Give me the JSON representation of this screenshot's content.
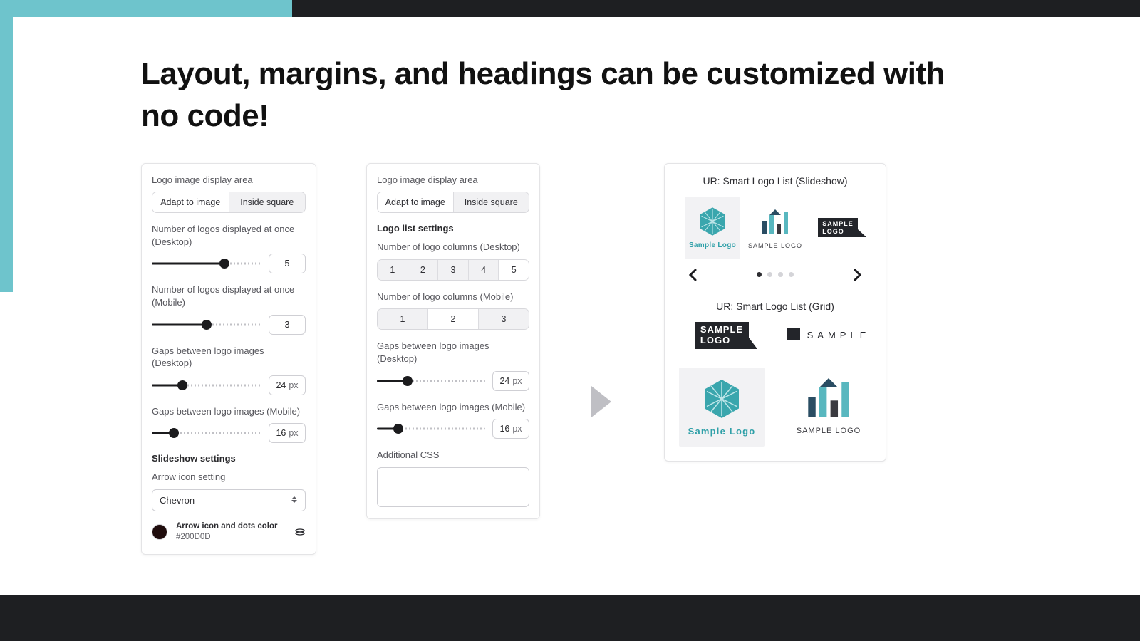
{
  "headline": "Layout, margins, and headings can be customized with no code!",
  "panelA": {
    "displayArea": {
      "label": "Logo image display area",
      "opt1": "Adapt to image",
      "opt2": "Inside square"
    },
    "logosDesktop": {
      "label": "Number of logos displayed at once (Desktop)",
      "value": "5",
      "pct": 66
    },
    "logosMobile": {
      "label": "Number of logos displayed at once (Mobile)",
      "value": "3",
      "pct": 50
    },
    "gapDesktop": {
      "label": "Gaps between logo images (Desktop)",
      "value": "24",
      "unit": "px",
      "pct": 28
    },
    "gapMobile": {
      "label": "Gaps between logo images (Mobile)",
      "value": "16",
      "unit": "px",
      "pct": 20
    },
    "slideshowHeading": "Slideshow settings",
    "arrowIconLabel": "Arrow icon setting",
    "arrowIconValue": "Chevron",
    "colorLabel": "Arrow icon and dots color",
    "colorHex": "#200D0D"
  },
  "panelB": {
    "displayArea": {
      "label": "Logo image display area",
      "opt1": "Adapt to image",
      "opt2": "Inside square"
    },
    "listHeading": "Logo list settings",
    "colsDesktop": {
      "label": "Number of logo columns (Desktop)",
      "opts": [
        "1",
        "2",
        "3",
        "4",
        "5"
      ],
      "activeIndex": 4
    },
    "colsMobile": {
      "label": "Number of logo columns (Mobile)",
      "opts": [
        "1",
        "2",
        "3"
      ],
      "activeIndex": 1
    },
    "gapDesktop": {
      "label": "Gaps between logo images (Desktop)",
      "value": "24",
      "unit": "px",
      "pct": 28
    },
    "gapMobile": {
      "label": "Gaps between logo images (Mobile)",
      "value": "16",
      "unit": "px",
      "pct": 20
    },
    "cssLabel": "Additional CSS"
  },
  "preview": {
    "slideshowTitle": "UR: Smart Logo List (Slideshow)",
    "gridTitle": "UR: Smart Logo List (Grid)",
    "cap1": "Sample Logo",
    "cap2": "SAMPLE LOGO",
    "badgeLine1": "SAMPLE",
    "badgeLine2": "LOGO",
    "sampleWord": "SAMPLE"
  }
}
